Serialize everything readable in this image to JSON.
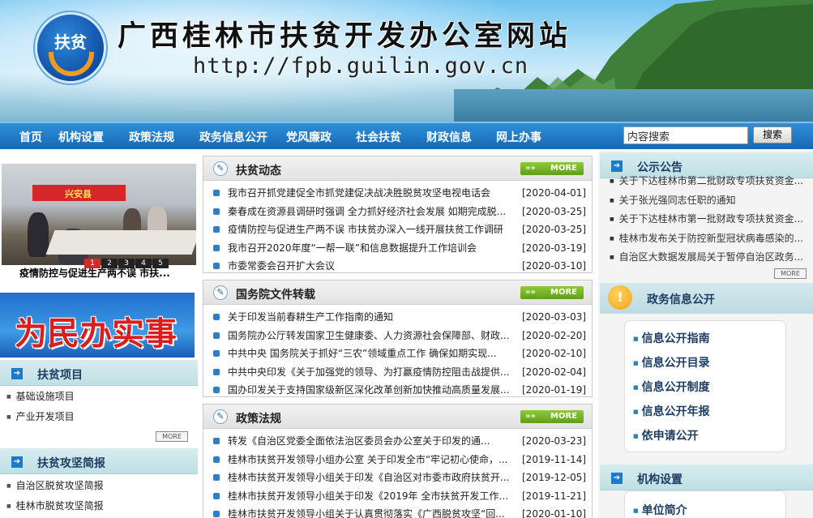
{
  "header": {
    "logo_text": "扶贫",
    "site_title": "广西桂林市扶贫开发办公室网站",
    "site_url": "http://fpb.guilin.gov.cn"
  },
  "nav": {
    "items": [
      "首页",
      "机构设置",
      "政策法规",
      "政务信息公开",
      "党风廉政",
      "社会扶贫",
      "财政信息",
      "网上办事"
    ],
    "search_value": "内容搜索",
    "search_button": "搜索"
  },
  "slideshow": {
    "image_banner_text": "兴安县",
    "pages": [
      "1",
      "2",
      "3",
      "4",
      "5"
    ],
    "active_page": "1",
    "caption": "疫情防控与促进生产两不误 市扶..."
  },
  "slogan": "为民办实事",
  "left_sections": [
    {
      "title": "扶贫项目",
      "items": [
        "基础设施项目",
        "产业开发项目"
      ],
      "more": "MORE"
    },
    {
      "title": "扶贫攻坚简报",
      "items": [
        "自治区脱贫攻坚简报",
        "桂林市脱贫攻坚简报"
      ]
    }
  ],
  "panels": [
    {
      "title": "扶贫动态",
      "more": "MORE",
      "items": [
        {
          "title": "我市召开抓党建促全市抓党建促决战决胜脱贫攻坚电视电话会",
          "date": "[2020-04-01]"
        },
        {
          "title": "秦春成在资源县调研时强调 全力抓好经济社会发展 如期完成脱...",
          "date": "[2020-03-25]"
        },
        {
          "title": "疫情防控与促进生产两不误 市扶贫办深入一线开展扶贫工作调研",
          "date": "[2020-03-25]"
        },
        {
          "title": "我市召开2020年度“一帮一联”和信息数据提升工作培训会",
          "date": "[2020-03-19]"
        },
        {
          "title": "市委常委会召开扩大会议",
          "date": "[2020-03-10]"
        }
      ]
    },
    {
      "title": "国务院文件转载",
      "more": "MORE",
      "items": [
        {
          "title": "关于印发当前春耕生产工作指南的通知",
          "date": "[2020-03-03]"
        },
        {
          "title": "国务院办公厅转发国家卫生健康委、人力资源社会保障部、财政...",
          "date": "[2020-02-20]"
        },
        {
          "title": "中共中央 国务院关于抓好“三农”领域重点工作 确保如期实现...",
          "date": "[2020-02-10]"
        },
        {
          "title": "中共中央印发《关于加强党的领导、为打赢疫情防控阻击战提供...",
          "date": "[2020-02-04]"
        },
        {
          "title": "国办印发关于支持国家级新区深化改革创新加快推动高质量发展...",
          "date": "[2020-01-19]"
        }
      ]
    },
    {
      "title": "政策法规",
      "more": "MORE",
      "items": [
        {
          "title": "转发《自治区党委全面依法治区委员会办公室关于印发的通...",
          "date": "[2020-03-23]"
        },
        {
          "title": "桂林市扶贫开发领导小组办公室 关于印发全市“牢记初心使命，...",
          "date": "[2019-11-14]"
        },
        {
          "title": "桂林市扶贫开发领导小组关于印发《自治区对市委市政府扶贫开...",
          "date": "[2019-12-05]"
        },
        {
          "title": "桂林市扶贫开发领导小组关于印发《2019年 全市扶贫开发工作成...",
          "date": "[2019-11-21]"
        },
        {
          "title": "桂林市扶贫开发领导小组关于认真贯彻落实《广西脱贫攻坚“回...",
          "date": "[2020-01-10]"
        }
      ]
    }
  ],
  "notice": {
    "title": "公示公告",
    "items": [
      "关于下达桂林市第二批财政专项扶贫资金...",
      "关于张光强同志任职的通知",
      "关于下达桂林市第一批财政专项扶贫资金...",
      "桂林市发布关于防控新型冠状病毒感染的...",
      "自治区大数据发展局关于暂停自治区政务..."
    ],
    "more": "MORE"
  },
  "gov_info": {
    "title": "政务信息公开",
    "items": [
      "信息公开指南",
      "信息公开目录",
      "信息公开制度",
      "信息公开年报",
      "依申请公开"
    ]
  },
  "org": {
    "title": "机构设置",
    "items": [
      "单位简介"
    ]
  },
  "colors": {
    "nav_blue": "#1c78c4",
    "more_green": "#6aaa22",
    "section_teal": "#c6e3e8",
    "slogan_red": "#d81e1e"
  }
}
